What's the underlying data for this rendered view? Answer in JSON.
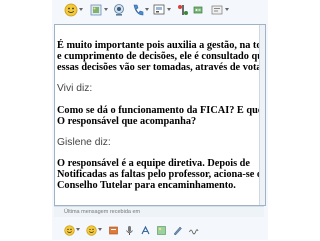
{
  "toolbar": {
    "icons": [
      "emoticon-icon",
      "send-file-icon",
      "webcam-icon",
      "call-icon",
      "activities-icon",
      "games-icon",
      "block-icon",
      "more-options-icon"
    ]
  },
  "chat": {
    "lines": [
      {
        "text": "É muito importante pois auxilia a gestão, na tomada",
        "bold": true
      },
      {
        "text": " e cumprimento de decisões, ele é consultado quando",
        "bold": true
      },
      {
        "text": " essas decisões vão ser tomadas, através de votações.",
        "bold": true
      },
      {
        "text": "Vivi diz:",
        "sender": true
      },
      {
        "text": "Como se dá o funcionamento da FICAI? E quem é",
        "bold": true
      },
      {
        "text": "O responsável que acompanha?",
        "bold": true
      },
      {
        "text": "Gislene diz:",
        "sender": true
      },
      {
        "text": "O responsável é a equipe diretiva. Depois de",
        "bold": true
      },
      {
        "text": "Notificadas as faltas pelo professor, aciona-se o",
        "bold": true
      },
      {
        "text": "Conselho Tutelar para encaminhamento.",
        "bold": true
      }
    ]
  },
  "status": {
    "text": "Última mensagem recebida em"
  },
  "bottom": {
    "icons": [
      "emoticon-smile-icon",
      "wink-icon",
      "nudge-icon",
      "voice-clip-icon",
      "text-style-icon",
      "background-icon",
      "ink-icon",
      "handwriting-icon"
    ]
  }
}
